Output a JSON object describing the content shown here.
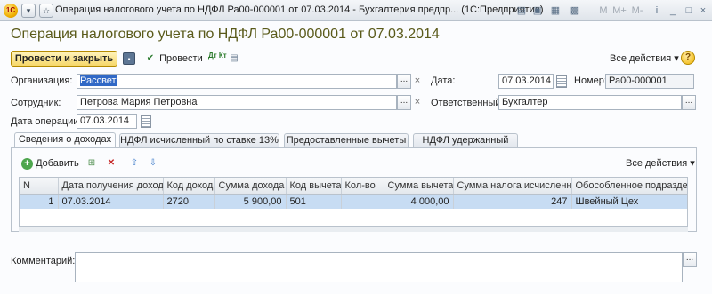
{
  "window": {
    "title": "Операция налогового учета по НДФЛ Ра00-000001 от 07.03.2014 - Бухгалтерия предпр... (1С:Предприятие)",
    "logo_text": "1С",
    "window_buttons": [
      "M",
      "M+",
      "M-"
    ]
  },
  "document": {
    "title": "Операция налогового учета по НДФЛ Ра00-000001 от 07.03.2014"
  },
  "toolbar": {
    "post_and_close_label": "Провести и закрыть",
    "post_label": "Провести",
    "dtkt_label": "Дт Кт",
    "all_actions_label": "Все действия ▾",
    "help_label": "?"
  },
  "form": {
    "organization_label": "Организация:",
    "organization_value": "Рассвет",
    "date_label": "Дата:",
    "date_value": "07.03.2014",
    "number_label": "Номер:",
    "number_value": "Ра00-000001",
    "employee_label": "Сотрудник:",
    "employee_value": "Петрова Мария Петровна",
    "responsible_label": "Ответственный:",
    "responsible_value": "Бухгалтер",
    "operation_date_label": "Дата операции:",
    "operation_date_value": "07.03.2014",
    "select_button": "...",
    "clear_button": "×"
  },
  "tabs": [
    {
      "label": "Сведения о доходах",
      "active": true
    },
    {
      "label": "НДФЛ исчисленный по ставке 13%",
      "active": false
    },
    {
      "label": "Предоставленные вычеты",
      "active": false
    },
    {
      "label": "НДФЛ удержанный",
      "active": false
    }
  ],
  "table_toolbar": {
    "add_label": "Добавить",
    "all_actions_label": "Все действия ▾"
  },
  "table": {
    "columns": [
      "N",
      "Дата получения дохода",
      "Код дохода",
      "Сумма дохода",
      "Код вычета",
      "Кол-во",
      "Сумма вычета",
      "Сумма налога исчисленная",
      "Обособленное подразделение"
    ],
    "rows": [
      [
        "1",
        "07.03.2014",
        "2720",
        "5 900,00",
        "501",
        "",
        "4 000,00",
        "247",
        "Швейный Цех"
      ]
    ]
  },
  "comment": {
    "label": "Комментарий:",
    "value": "",
    "select_button": "..."
  }
}
